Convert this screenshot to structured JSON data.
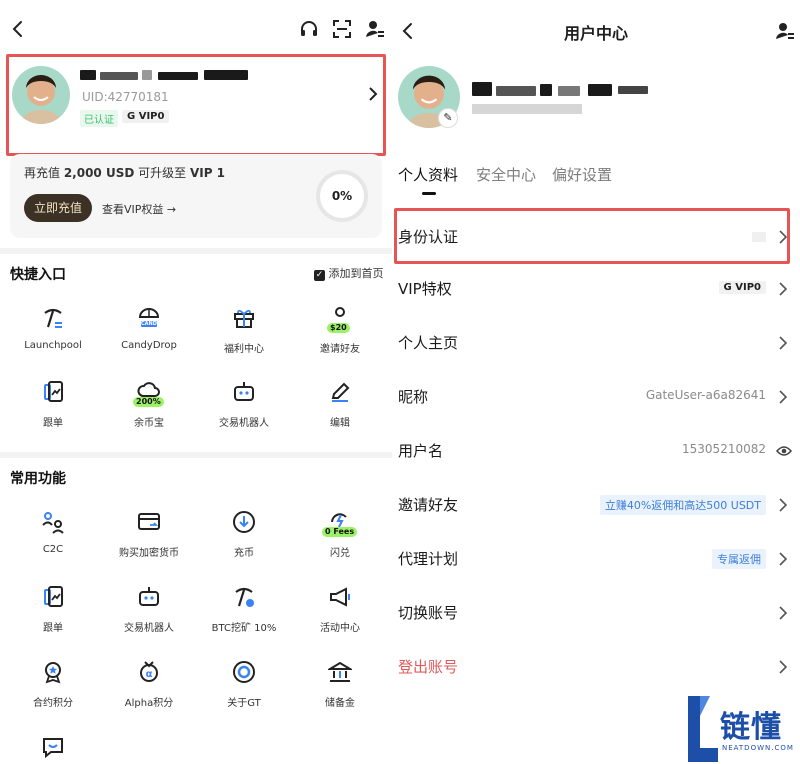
{
  "left": {
    "profile": {
      "uid": "UID:42770181",
      "verified_badge": "已认证",
      "vip_badge": "VIP0"
    },
    "upgrade": {
      "text_prefix": "再充值 ",
      "amount": "2,000 USD",
      "text_mid": " 可升级至 ",
      "target": "VIP 1",
      "deposit_button": "立即充值",
      "view_benefits": "查看VIP权益",
      "progress": "0%"
    },
    "quick": {
      "title": "快捷入口",
      "add_home": "添加到首页",
      "items": [
        {
          "label": "Launchpool",
          "icon": "pickaxe-icon"
        },
        {
          "label": "CandyDrop",
          "icon": "candy-parachute-icon",
          "tag": "CANDY"
        },
        {
          "label": "福利中心",
          "icon": "gift-icon"
        },
        {
          "label": "邀请好友",
          "icon": "invite-user-icon",
          "tag": "$20"
        },
        {
          "label": "跟单",
          "icon": "copy-trade-icon"
        },
        {
          "label": "余币宝",
          "icon": "cloud-coin-icon",
          "tag": "200%"
        },
        {
          "label": "交易机器人",
          "icon": "robot-icon"
        },
        {
          "label": "编辑",
          "icon": "edit-pencil-icon"
        }
      ]
    },
    "common": {
      "title": "常用功能",
      "items": [
        {
          "label": "C2C",
          "icon": "c2c-users-icon"
        },
        {
          "label": "购买加密货币",
          "icon": "card-buy-icon"
        },
        {
          "label": "充币",
          "icon": "deposit-arrow-icon"
        },
        {
          "label": "闪兑",
          "icon": "flash-swap-icon",
          "tag": "0 Fees"
        },
        {
          "label": "跟单",
          "icon": "copy-trade-icon"
        },
        {
          "label": "交易机器人",
          "icon": "robot-icon"
        },
        {
          "label": "BTC挖矿 10%",
          "icon": "btc-mining-icon"
        },
        {
          "label": "活动中心",
          "icon": "megaphone-icon"
        },
        {
          "label": "合约积分",
          "icon": "medal-icon"
        },
        {
          "label": "Alpha积分",
          "icon": "alpha-medal-icon"
        },
        {
          "label": "关于GT",
          "icon": "gt-coin-icon"
        },
        {
          "label": "储备金",
          "icon": "bank-icon"
        }
      ]
    }
  },
  "right": {
    "header": {
      "title": "用户中心"
    },
    "tabs": [
      {
        "label": "个人资料"
      },
      {
        "label": "安全中心"
      },
      {
        "label": "偏好设置"
      }
    ],
    "rows": [
      {
        "label": "身份认证",
        "value": ""
      },
      {
        "label": "VIP特权",
        "value": "VIP0"
      },
      {
        "label": "个人主页",
        "value": ""
      },
      {
        "label": "昵称",
        "value": "GateUser-a6a82641"
      },
      {
        "label": "用户名",
        "value": "15305210082"
      },
      {
        "label": "邀请好友",
        "value": "立赚40%返佣和高达500 USDT"
      },
      {
        "label": "代理计划",
        "value": "专属返佣"
      },
      {
        "label": "切换账号",
        "value": ""
      },
      {
        "label": "登出账号",
        "value": ""
      }
    ]
  },
  "watermark": {
    "brand": "链懂",
    "domain": "NEATDOWN.COM"
  },
  "colors": {
    "highlight_red": "#e55556",
    "logout_red": "#e05a5a",
    "tag_blue": "#3d7fd9",
    "dark_button": "#3b3125",
    "verified_green": "#3fbf6d"
  }
}
